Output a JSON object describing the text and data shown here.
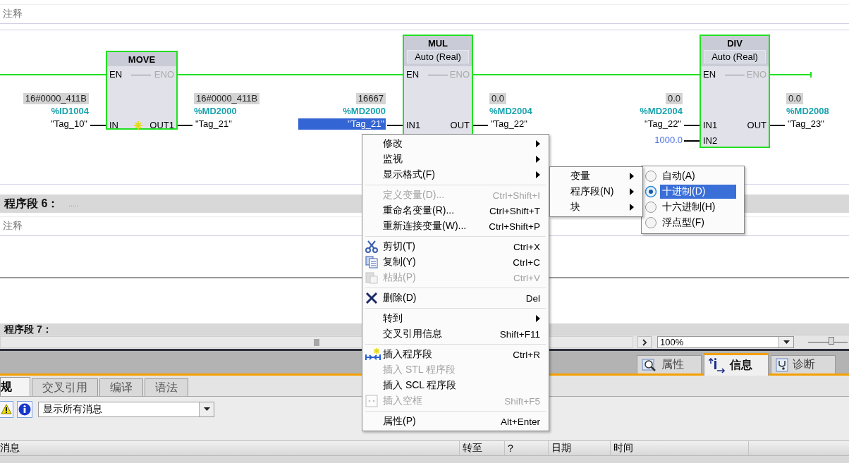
{
  "network_5": {
    "comment": "注释",
    "blocks": [
      {
        "name": "MOVE",
        "en": "EN",
        "eno": "ENO",
        "inputs": [
          {
            "pin": "IN",
            "value": "16#0000_411B",
            "address": "%ID1004",
            "tag": "\"Tag_10\"",
            "selected": false
          }
        ],
        "outputs": [
          {
            "pin": "OUT1",
            "value": "16#0000_411B",
            "address": "%MD2000",
            "tag": "\"Tag_21\""
          }
        ]
      },
      {
        "name": "MUL",
        "data_type": "Auto (Real)",
        "en": "EN",
        "eno": "ENO",
        "inputs": [
          {
            "pin": "IN1",
            "value": "16667",
            "address": "%MD2000",
            "tag": "\"Tag_21\"",
            "selected": true
          }
        ],
        "outputs": [
          {
            "pin": "OUT",
            "value": "0.0",
            "address": "%MD2004",
            "tag": "\"Tag_22\""
          }
        ]
      },
      {
        "name": "DIV",
        "data_type": "Auto (Real)",
        "en": "EN",
        "eno": "ENO",
        "inputs": [
          {
            "pin": "IN1",
            "value": "0.0",
            "address": "%MD2004",
            "tag": "\"Tag_22\"",
            "selected": false
          },
          {
            "pin": "IN2",
            "constant": "1000.0"
          }
        ],
        "outputs": [
          {
            "pin": "OUT",
            "value": "0.0",
            "address": "%MD2008",
            "tag": "\"Tag_23\""
          }
        ]
      }
    ]
  },
  "network_6": {
    "title": "程序段 6：",
    "title_placeholder": ".....",
    "comment": "注释"
  },
  "network_7": {
    "title": "程序段 7："
  },
  "editor_toolbar": {
    "zoom": "100%",
    "zoom_slider": {
      "level": 0.6
    }
  },
  "inspector_tabs": [
    {
      "label": "属性",
      "selected": false
    },
    {
      "label": "信息",
      "selected": true
    },
    {
      "label": "诊断",
      "selected": false
    }
  ],
  "info_tabs": [
    {
      "label": "规",
      "selected": true
    },
    {
      "label": "交叉引用",
      "selected": false
    },
    {
      "label": "编译",
      "selected": false
    },
    {
      "label": "语法",
      "selected": false
    }
  ],
  "message_filter": {
    "value": "显示所有消息"
  },
  "message_table": {
    "columns": [
      "消息",
      "转至",
      "?",
      "日期",
      "时间"
    ]
  },
  "context_menu": {
    "items": [
      {
        "kind": "item",
        "label": "修改",
        "arrow": true,
        "disabled": false
      },
      {
        "kind": "item",
        "label": "监视",
        "arrow": true,
        "disabled": false
      },
      {
        "kind": "item",
        "label": "显示格式(F)",
        "arrow": true,
        "disabled": false,
        "submenu": {
          "items": [
            {
              "label": "变量",
              "arrow": true,
              "submenu": {
                "items": [
                  {
                    "label": "自动(A)",
                    "selected": false
                  },
                  {
                    "label": "十进制(D)",
                    "selected": true
                  },
                  {
                    "label": "十六进制(H)",
                    "selected": false
                  },
                  {
                    "label": "浮点型(F)",
                    "selected": false
                  }
                ]
              }
            },
            {
              "label": "程序段(N)",
              "arrow": true
            },
            {
              "label": "块",
              "arrow": true
            }
          ]
        }
      },
      {
        "kind": "separator"
      },
      {
        "kind": "item",
        "label": "定义变量(D)...",
        "shortcut": "Ctrl+Shift+I",
        "arrow": false,
        "disabled": true
      },
      {
        "kind": "item",
        "label": "重命名变量(R)...",
        "shortcut": "Ctrl+Shift+T",
        "arrow": false,
        "disabled": false
      },
      {
        "kind": "item",
        "label": "重新连接变量(W)...",
        "shortcut": "Ctrl+Shift+P",
        "arrow": false,
        "disabled": false
      },
      {
        "kind": "separator"
      },
      {
        "kind": "item",
        "label": "剪切(T)",
        "shortcut": "Ctrl+X",
        "arrow": false,
        "disabled": false
      },
      {
        "kind": "item",
        "label": "复制(Y)",
        "shortcut": "Ctrl+C",
        "arrow": false,
        "disabled": false
      },
      {
        "kind": "item",
        "label": "粘贴(P)",
        "shortcut": "Ctrl+V",
        "arrow": false,
        "disabled": true
      },
      {
        "kind": "separator"
      },
      {
        "kind": "item",
        "label": "删除(D)",
        "shortcut": "Del",
        "arrow": false,
        "disabled": false
      },
      {
        "kind": "separator"
      },
      {
        "kind": "item",
        "label": "转到",
        "arrow": true,
        "disabled": false
      },
      {
        "kind": "item",
        "label": "交叉引用信息",
        "shortcut": "Shift+F11",
        "arrow": false,
        "disabled": false
      },
      {
        "kind": "separator"
      },
      {
        "kind": "item",
        "label": "插入程序段",
        "shortcut": "Ctrl+R",
        "arrow": false,
        "disabled": false
      },
      {
        "kind": "item",
        "label": "插入 STL 程序段",
        "arrow": false,
        "disabled": true
      },
      {
        "kind": "item",
        "label": "插入 SCL 程序段",
        "arrow": false,
        "disabled": false
      },
      {
        "kind": "item",
        "label": "插入空框",
        "shortcut": "Shift+F5",
        "arrow": false,
        "disabled": true
      },
      {
        "kind": "separator"
      },
      {
        "kind": "item",
        "label": "属性(P)",
        "shortcut": "Alt+Enter",
        "arrow": false,
        "disabled": false
      }
    ]
  }
}
